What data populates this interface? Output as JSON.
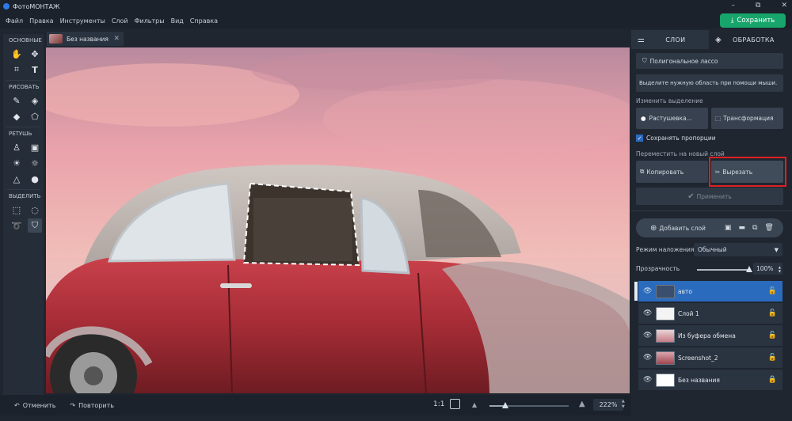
{
  "app": {
    "title": "ФотоМОНТАЖ"
  },
  "window": {
    "minimize": "–",
    "restore": "⧉",
    "close": "✕"
  },
  "menu": [
    "Файл",
    "Правка",
    "Инструменты",
    "Слой",
    "Фильтры",
    "Вид",
    "Справка"
  ],
  "save_button": "Сохранить",
  "toolbox": {
    "basic": "ОСНОВНЫЕ",
    "draw": "РИСОВАТЬ",
    "retouch": "РЕТУШЬ",
    "select": "ВЫДЕЛИТЬ"
  },
  "document_tab": {
    "title": "Без названия",
    "close": "✕"
  },
  "bottombar": {
    "undo": "Отменить",
    "redo": "Повторить",
    "ratio": "1:1",
    "zoom": "222%",
    "zoom_level": 0.2
  },
  "panel": {
    "tabs": [
      "СЛОИ",
      "ОБРАБОТКА"
    ],
    "tool_name": "Полигональное лассо",
    "hint": "Выделите нужную область при помощи мыши.",
    "change_selection_label": "Изменить выделение",
    "feather_button": "Растушевка...",
    "transform_button": "Трансформация",
    "keep_proportions": "Сохранять пропорции",
    "move_to_layer_label": "Переместить на новый слой",
    "copy_button": "Копировать",
    "cut_button": "Вырезать",
    "apply_button": "Применить",
    "add_layer_button": "Добавить слой",
    "blend_mode_label": "Режим наложения:",
    "blend_mode_value": "Обычный",
    "opacity_label": "Прозрачность",
    "opacity_value": "100%",
    "opacity_level": 1.0,
    "layers": [
      {
        "name": "авто",
        "active": true
      },
      {
        "name": "Слой 1",
        "active": false
      },
      {
        "name": "Из буфера обмена",
        "active": false
      },
      {
        "name": "Screenshot_2",
        "active": false
      },
      {
        "name": "Без названия",
        "active": false
      }
    ]
  },
  "colors": {
    "accent_green": "#17a56b",
    "highlight_red": "#e02020",
    "active_layer": "#2b6bbd"
  }
}
